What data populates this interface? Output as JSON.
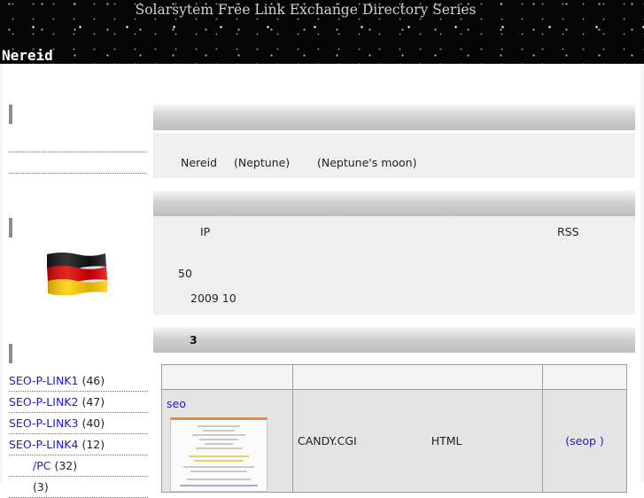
{
  "header": {
    "site_title": "Solarsytem Free Link Exchange Directory Series",
    "page_name": "Nereid"
  },
  "section1": {
    "name": "Nereid",
    "planet": "(Neptune)",
    "desc": "(Neptune's moon)"
  },
  "section2": {
    "ip": "IP",
    "rss": "RSS",
    "count": "50",
    "date": "2009 10"
  },
  "section3": {
    "heading": "3"
  },
  "sidebar": {
    "links": [
      {
        "label": "SEO-P-LINK1",
        "count": "(46)"
      },
      {
        "label": "SEO-P-LINK2",
        "count": "(47)"
      },
      {
        "label": "SEO-P-LINK3",
        "count": "(40)"
      },
      {
        "label": "SEO-P-LINK4",
        "count": "(12)"
      },
      {
        "label": "/PC",
        "count": "(32)"
      }
    ],
    "partial_count": "(3)"
  },
  "table": {
    "link_text": "seo",
    "file": "CANDY.CGI",
    "type": "HTML",
    "seop": "(seop )"
  },
  "colors": {
    "link": "#1a1ad0",
    "bar_gradient": "#bdbdbd",
    "flag": [
      "#000000",
      "#dd0000",
      "#ffce00"
    ]
  },
  "icons": {
    "flag": "german-flag-icon"
  }
}
